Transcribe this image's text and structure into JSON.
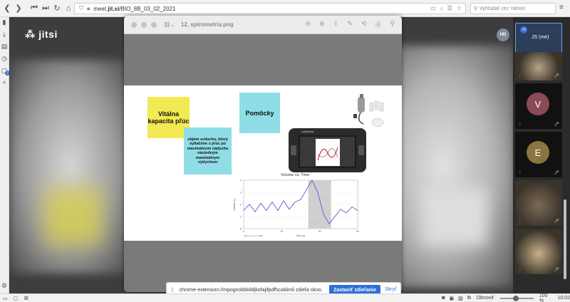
{
  "browser": {
    "url_prefix": "meet.",
    "url_domain": "jit.si",
    "url_path": "/BIO_8B_03_02_2021",
    "search_placeholder": "Vyhľadať cez Yahoo!",
    "status_refresh": "Obnoviť",
    "zoom": "100 %",
    "time": "10:02",
    "sidebar_badge": "2"
  },
  "jitsi": {
    "logo": "jitsi"
  },
  "preview": {
    "title": "12_spirometria.png"
  },
  "slide": {
    "sticky_yellow": "Vitálna kapacita pľúc",
    "sticky_blue_title": "Pomôcky",
    "sticky_blue_text": "objem vzduchu, ktorý vytlačíme z pľúc po maximálnom nádychu následným maximálnym výdychom",
    "labquest_logo": "LabQuest",
    "chart_caption": "Volume vs. Time"
  },
  "chart_data": {
    "type": "line",
    "title": "Volume vs. Time",
    "xlabel": "Time (s)",
    "ylabel": "Volume (L)",
    "xlim": [
      0,
      30
    ],
    "ylim": [
      0,
      4
    ],
    "x_ticks": [
      "0",
      "10",
      "20",
      "30"
    ],
    "y_ticks": [
      "0",
      "1",
      "2",
      "3",
      "4"
    ],
    "footnote": "(32.8, 1.1) (s, 0.000)",
    "highlight_range": [
      17,
      23
    ],
    "series": [
      {
        "x": [
          0,
          1.5,
          3,
          4.5,
          6,
          7.5,
          9,
          10.5,
          12,
          13.5,
          15,
          16.5,
          18,
          19.5,
          21,
          22.5,
          24,
          25.5,
          27,
          28.5,
          30
        ],
        "values": [
          1.5,
          2.0,
          1.4,
          2.1,
          1.5,
          2.2,
          1.5,
          2.3,
          1.6,
          2.2,
          2.4,
          3.2,
          4.0,
          3.0,
          1.2,
          0.4,
          1.0,
          1.6,
          1.3,
          1.8,
          1.5
        ]
      }
    ]
  },
  "share": {
    "grip": "||",
    "notice": "chrome-extension://mpognobbkildjkofajifpdfhcoklimli zdieľa okno.",
    "stop_label": "Zastaviť zdieľanie",
    "hide_label": "Skryť"
  },
  "participants": {
    "hd_avatar": "HD",
    "me_initials": "JS",
    "me_label": "JS (me)",
    "tiles": [
      {
        "initial": "",
        "color": "#b8a48a"
      },
      {
        "initial": "V",
        "color": "#8a4a57"
      },
      {
        "initial": "E",
        "color": "#8a7440"
      },
      {
        "initial": "",
        "color": "#7a6a55"
      },
      {
        "initial": "",
        "color": "#c9b08a"
      }
    ]
  }
}
